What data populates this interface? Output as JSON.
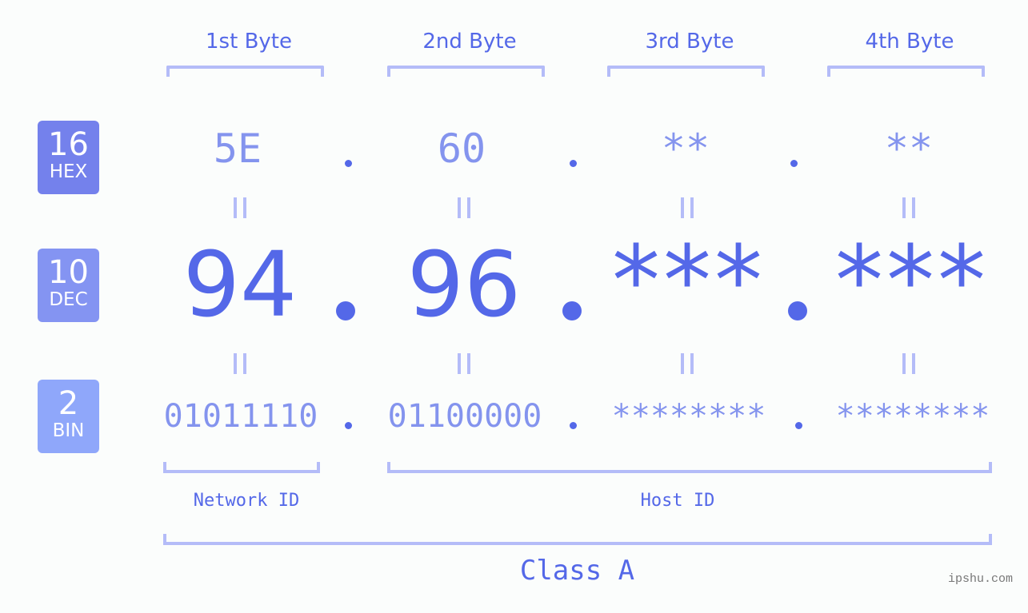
{
  "byte_headers": [
    "1st Byte",
    "2nd Byte",
    "3rd Byte",
    "4th Byte"
  ],
  "badges": {
    "hex": {
      "number": "16",
      "label": "HEX",
      "color": "#7481ec"
    },
    "dec": {
      "number": "10",
      "label": "DEC",
      "color": "#8494f2"
    },
    "bin": {
      "number": "2",
      "label": "BIN",
      "color": "#8fa7fa"
    }
  },
  "hex_values": [
    "5E",
    "60",
    "**",
    "**"
  ],
  "dec_values": [
    "94",
    "96",
    "***",
    "***"
  ],
  "bin_values": [
    "01011110",
    "01100000",
    "********",
    "********"
  ],
  "separator": ".",
  "network_id_label": "Network ID",
  "host_id_label": "Host ID",
  "class_label": "Class A",
  "watermark": "ipshu.com",
  "colors": {
    "accent": "#5468e8",
    "light_accent": "#8494ee",
    "bracket": "#b4bcf8",
    "background": "#fbfdfc"
  }
}
